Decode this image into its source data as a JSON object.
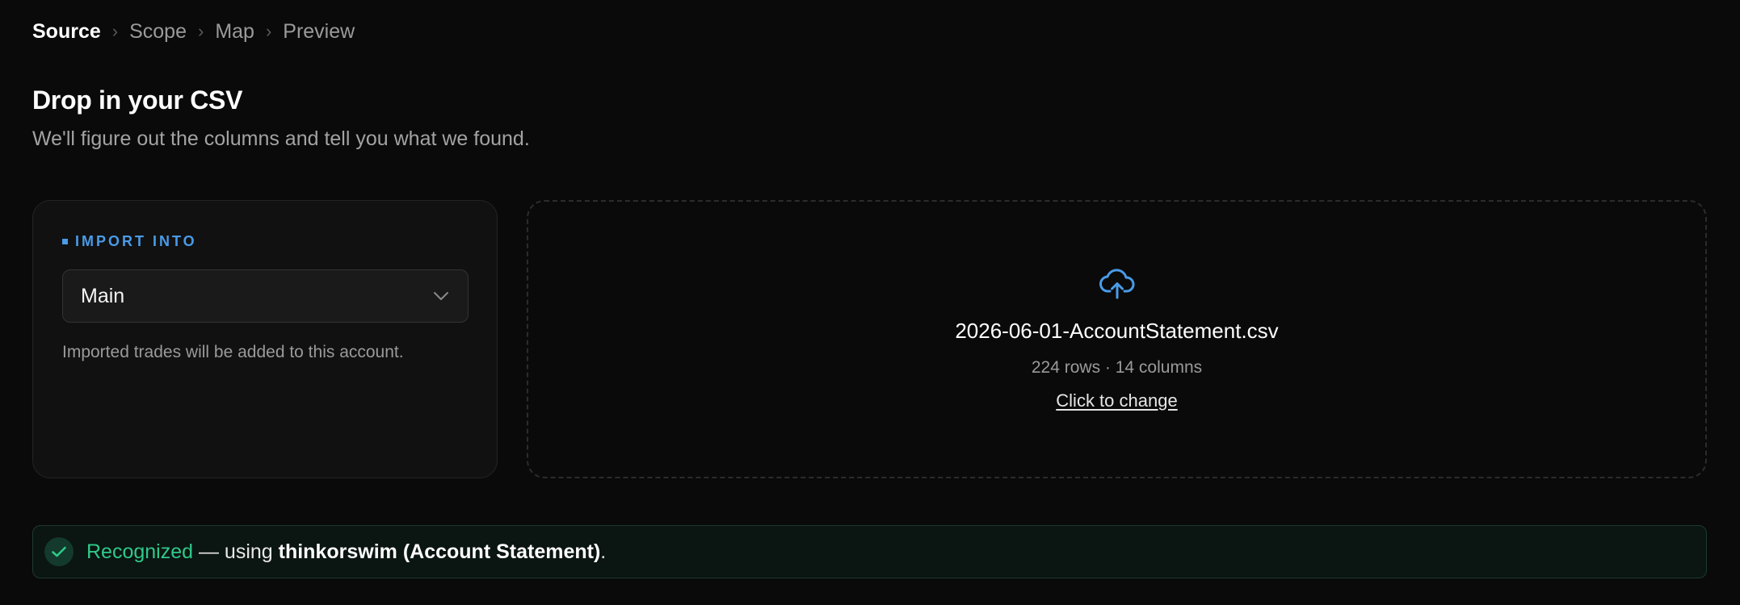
{
  "breadcrumb": {
    "steps": [
      "Source",
      "Scope",
      "Map",
      "Preview"
    ],
    "separator": "›"
  },
  "header": {
    "title": "Drop in your CSV",
    "subtitle": "We'll figure out the columns and tell you what we found."
  },
  "import_into": {
    "label": "IMPORT INTO",
    "selected_account": "Main",
    "help_text": "Imported trades will be added to this account."
  },
  "dropzone": {
    "icon": "cloud-upload-icon",
    "file_name": "2026-06-01-AccountStatement.csv",
    "file_meta": "224 rows · 14 columns",
    "change_label": "Click to change"
  },
  "banner": {
    "status": "Recognized",
    "prefix": " — using ",
    "source": "thinkorswim (Account Statement)",
    "suffix": "."
  },
  "colors": {
    "accent_blue": "#4a9be8",
    "success_green": "#2fc98a",
    "background": "#0a0a0a"
  }
}
